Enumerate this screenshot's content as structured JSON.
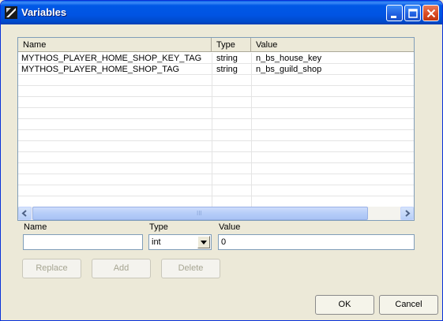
{
  "window": {
    "title": "Variables",
    "minimize_label": "Minimize",
    "maximize_label": "Maximize",
    "close_label": "Close"
  },
  "list": {
    "columns": [
      "Name",
      "Type",
      "Value"
    ],
    "rows": [
      {
        "name": "MYTHOS_PLAYER_HOME_SHOP_KEY_TAG",
        "type": "string",
        "value": "n_bs_house_key"
      },
      {
        "name": "MYTHOS_PLAYER_HOME_SHOP_TAG",
        "type": "string",
        "value": "n_bs_guild_shop"
      }
    ],
    "scrollbar_grip": "III"
  },
  "form": {
    "name_label": "Name",
    "name_value": "",
    "type_label": "Type",
    "type_value": "int",
    "value_label": "Value",
    "value_value": "0"
  },
  "buttons": {
    "replace": "Replace",
    "add": "Add",
    "delete": "Delete",
    "ok": "OK",
    "cancel": "Cancel"
  }
}
